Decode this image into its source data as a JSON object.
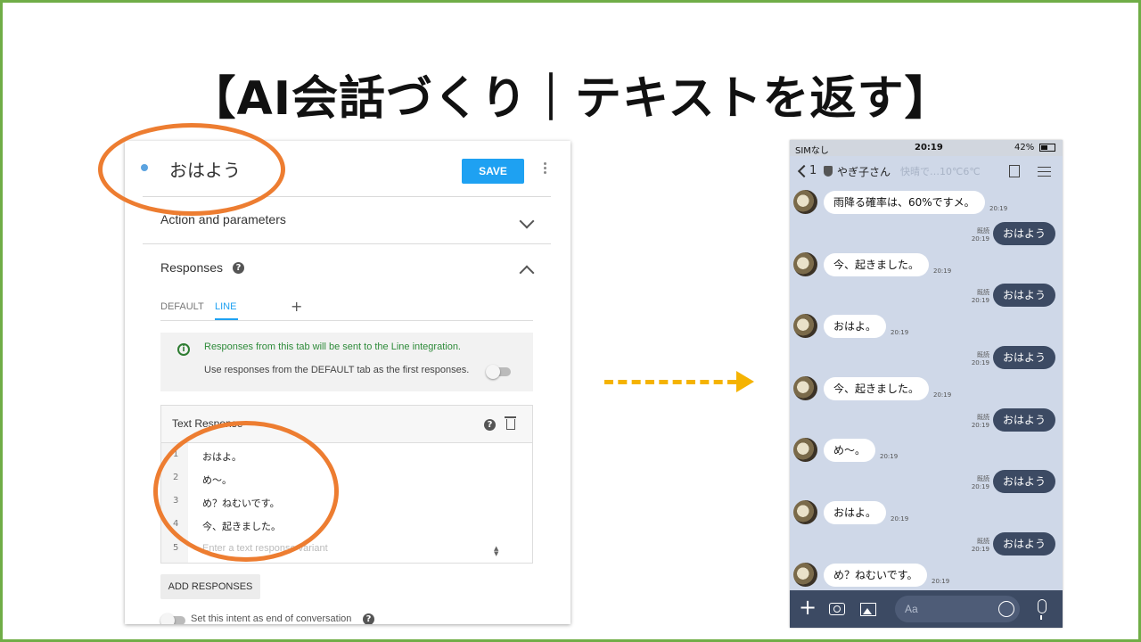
{
  "slide_title": "【AI会話づくり｜テキストを返す】",
  "dialogflow": {
    "intent_name": "おはよう",
    "save_label": "SAVE",
    "action_section": "Action and parameters",
    "responses_section": "Responses",
    "help_glyph": "?",
    "tabs": {
      "default": "DEFAULT",
      "line": "LINE",
      "add": "+"
    },
    "info": {
      "line1": "Responses from this tab will be sent to the Line integration.",
      "line2": "Use responses from the DEFAULT tab as the first responses."
    },
    "text_responses": {
      "title": "Text Response",
      "rows": [
        {
          "num": "1",
          "text": "おはよ。"
        },
        {
          "num": "2",
          "text": "め〜。"
        },
        {
          "num": "3",
          "text": "め？ねむいです。"
        },
        {
          "num": "4",
          "text": "今、起きました。"
        }
      ],
      "placeholder_num": "5",
      "placeholder": "Enter a text response variant"
    },
    "add_responses": "ADD RESPONSES",
    "end_conversation": "Set this intent as end of conversation",
    "colors": {
      "accent": "#1ea1f2",
      "info_text": "#2e8b3a"
    }
  },
  "phone": {
    "status": {
      "carrier": "SIMなし",
      "time": "20:19",
      "battery": "42%"
    },
    "header": {
      "back_count": "1",
      "name": "やぎ子さん",
      "ghost": "快晴で…10℃6℃"
    },
    "messages": [
      {
        "side": "left",
        "text": "雨降る確率は、60%ですメ。",
        "time": "20:19"
      },
      {
        "side": "right",
        "text": "おはよう",
        "read": "既読",
        "time": "20:19"
      },
      {
        "side": "left",
        "text": "今、起きました。",
        "time": "20:19"
      },
      {
        "side": "right",
        "text": "おはよう",
        "read": "既読",
        "time": "20:19"
      },
      {
        "side": "left",
        "text": "おはよ。",
        "time": "20:19"
      },
      {
        "side": "right",
        "text": "おはよう",
        "read": "既読",
        "time": "20:19"
      },
      {
        "side": "left",
        "text": "今、起きました。",
        "time": "20:19"
      },
      {
        "side": "right",
        "text": "おはよう",
        "read": "既読",
        "time": "20:19"
      },
      {
        "side": "left",
        "text": "め〜。",
        "time": "20:19"
      },
      {
        "side": "right",
        "text": "おはよう",
        "read": "既読",
        "time": "20:19"
      },
      {
        "side": "left",
        "text": "おはよ。",
        "time": "20:19"
      },
      {
        "side": "right",
        "text": "おはよう",
        "read": "既読",
        "time": "20:19"
      },
      {
        "side": "left",
        "text": "め？ねむいです。",
        "time": "20:19"
      }
    ],
    "input_placeholder": "Aa",
    "colors": {
      "chat_bg": "#cfd8e8",
      "own_bubble": "#3c4a63"
    }
  },
  "colors": {
    "frame": "#70ad47",
    "highlight_circle": "#ed7d31",
    "arrow": "#f5b301"
  }
}
